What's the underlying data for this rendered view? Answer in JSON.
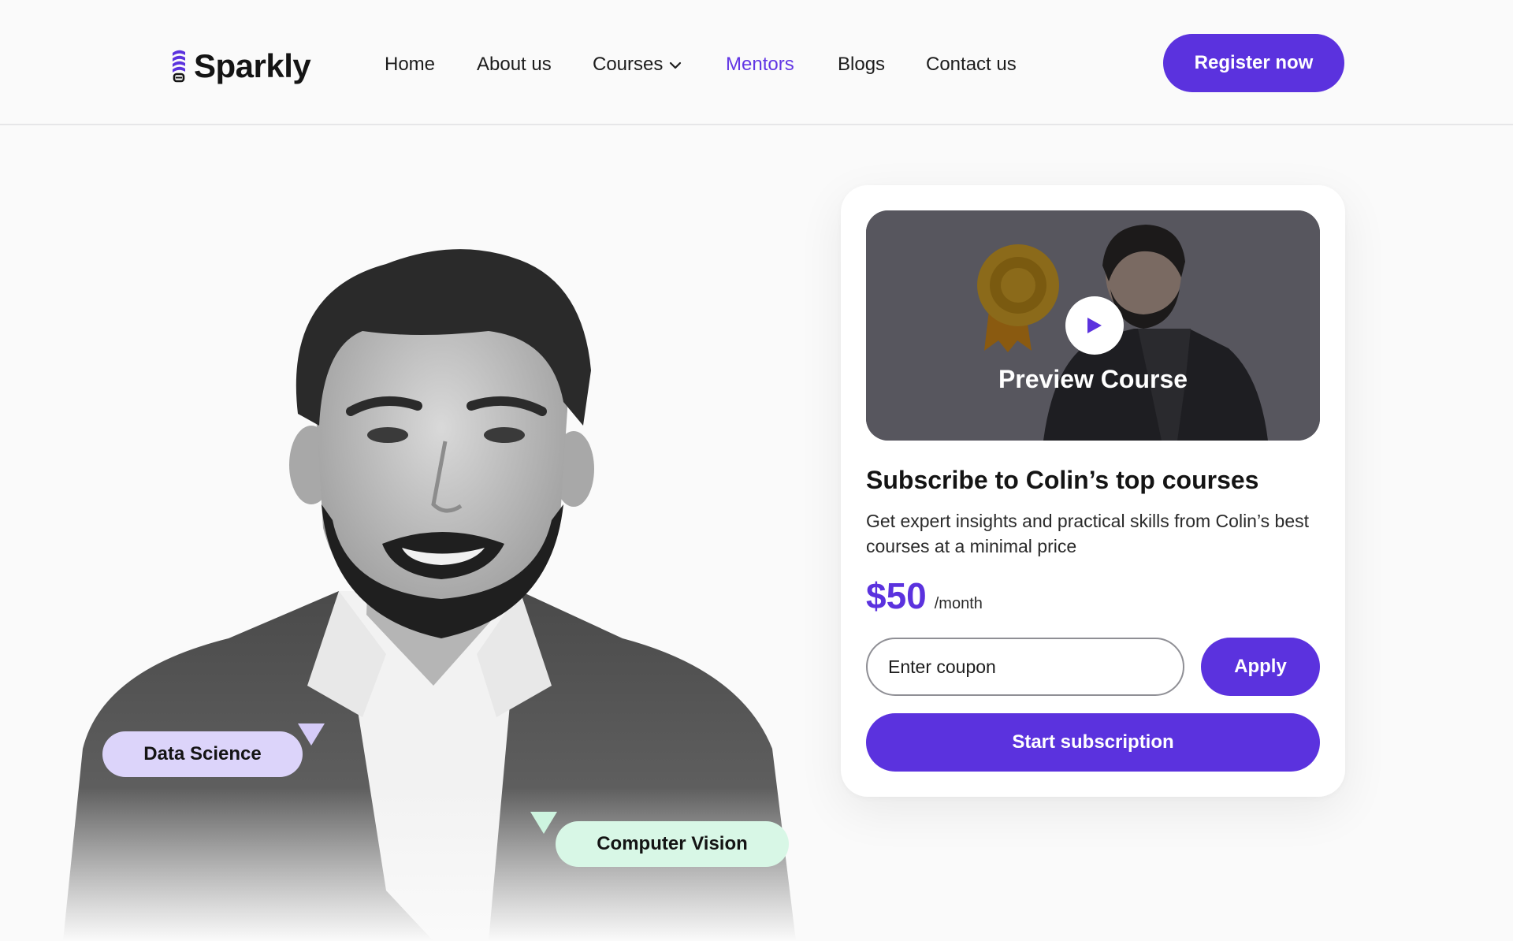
{
  "brand": {
    "name": "Sparkly",
    "accent": "#5b32de",
    "logo_icon": "lightbulb-spiral-icon"
  },
  "nav": {
    "items": [
      {
        "label": "Home",
        "active": false
      },
      {
        "label": "About us",
        "active": false
      },
      {
        "label": "Courses",
        "active": false,
        "icon": "chevron-down-icon"
      },
      {
        "label": "Mentors",
        "active": true
      },
      {
        "label": "Blogs",
        "active": false
      },
      {
        "label": "Contact us",
        "active": false
      }
    ],
    "cta_label": "Register now"
  },
  "hero": {
    "portrait": "mentor-portrait",
    "tags": [
      {
        "label": "Data Science",
        "color": "#dcd4fa"
      },
      {
        "label": "Computer Vision",
        "color": "#d8f7e6"
      }
    ]
  },
  "subscription": {
    "video_label": "Preview Course",
    "play_icon": "play-icon",
    "title": "Subscribe to Colin’s top courses",
    "description": "Get expert insights and practical skills from Colin’s best courses at a minimal price",
    "price": "$50",
    "period": "/month",
    "coupon_placeholder": "Enter coupon",
    "coupon_value": "",
    "apply_label": "Apply",
    "start_label": "Start subscription"
  }
}
